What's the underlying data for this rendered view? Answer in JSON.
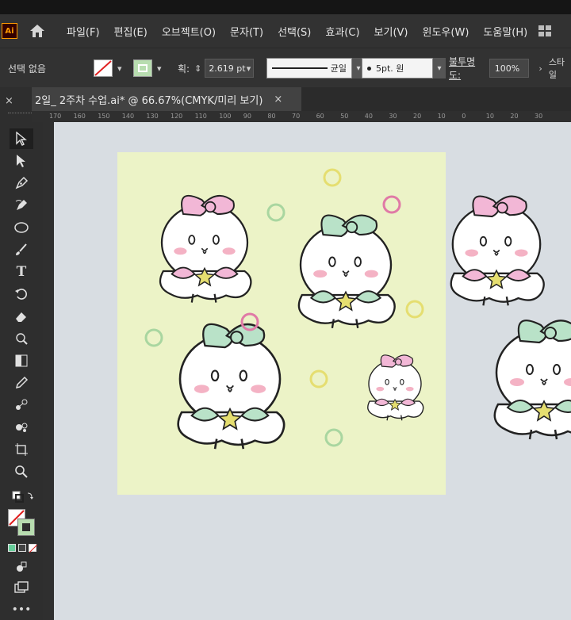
{
  "app": {
    "logo": "Ai",
    "menu": [
      "파일(F)",
      "편집(E)",
      "오브젝트(O)",
      "문자(T)",
      "선택(S)",
      "효과(C)",
      "보기(V)",
      "윈도우(W)",
      "도움말(H)"
    ]
  },
  "control": {
    "selection_state": "선택 없음",
    "stroke_label": "획:",
    "stroke_weight": "2.619 pt",
    "profile_label": "균일",
    "brush_label": "5pt. 원",
    "opacity_label": "불투명도:",
    "opacity_value": "100%",
    "style_label": "스타일"
  },
  "document": {
    "tab_title": "2일_ 2주차 수업.ai* @ 66.67%(CMYK/미리 보기)",
    "close": "×"
  },
  "ruler_ticks": [
    "170",
    "160",
    "150",
    "140",
    "130",
    "120",
    "110",
    "100",
    "90",
    "80",
    "70",
    "60",
    "50",
    "40",
    "30",
    "20",
    "10",
    "0",
    "10",
    "20",
    "30"
  ],
  "colors": {
    "artboard_bg": "#ecf3c7",
    "pink": "#f2b7d6",
    "mint": "#b9e2c8",
    "yellow": "#e5de70",
    "magenta": "#e07aa6",
    "green": "#a9d6a0"
  },
  "icons": {
    "tools": [
      "selection-tool-icon",
      "direct-selection-tool-icon",
      "pen-tool-icon",
      "curvature-tool-icon",
      "ellipse-tool-icon",
      "paintbrush-tool-icon",
      "type-tool-icon",
      "rotate-tool-icon",
      "eraser-tool-icon",
      "warp-tool-icon",
      "gradient-tool-icon",
      "eyedropper-tool-icon",
      "blend-tool-icon",
      "symbol-sprayer-tool-icon",
      "artboard-tool-icon",
      "zoom-tool-icon"
    ]
  }
}
